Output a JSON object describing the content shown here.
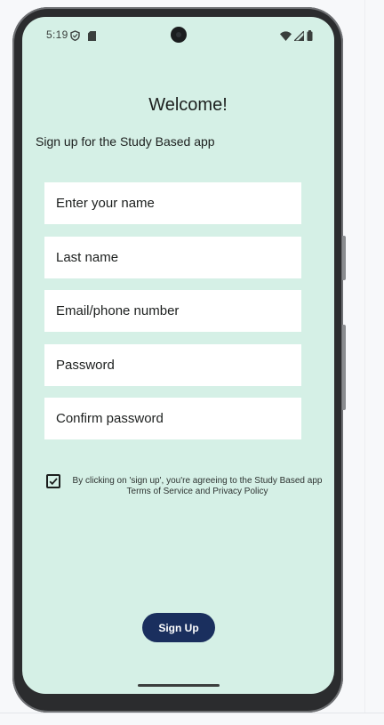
{
  "status_bar": {
    "time": "5:19",
    "icons": [
      "shield-icon",
      "sim-card-icon",
      "wifi-icon",
      "signal-icon",
      "battery-icon"
    ]
  },
  "header": {
    "title": "Welcome!",
    "subtitle": "Sign up for the Study Based app"
  },
  "form": {
    "first_name_placeholder": "Enter your name",
    "last_name_placeholder": "Last name",
    "contact_placeholder": "Email/phone number",
    "password_placeholder": "Password",
    "confirm_password_placeholder": "Confirm password"
  },
  "terms": {
    "checked": true,
    "text": "By clicking on 'sign up', you're agreeing to the Study Based app Terms of Service and Privacy Policy"
  },
  "actions": {
    "signup_label": "Sign Up"
  },
  "colors": {
    "screen_background": "#d5f0e6",
    "button_background": "#1a2f5e",
    "field_background": "#ffffff"
  }
}
